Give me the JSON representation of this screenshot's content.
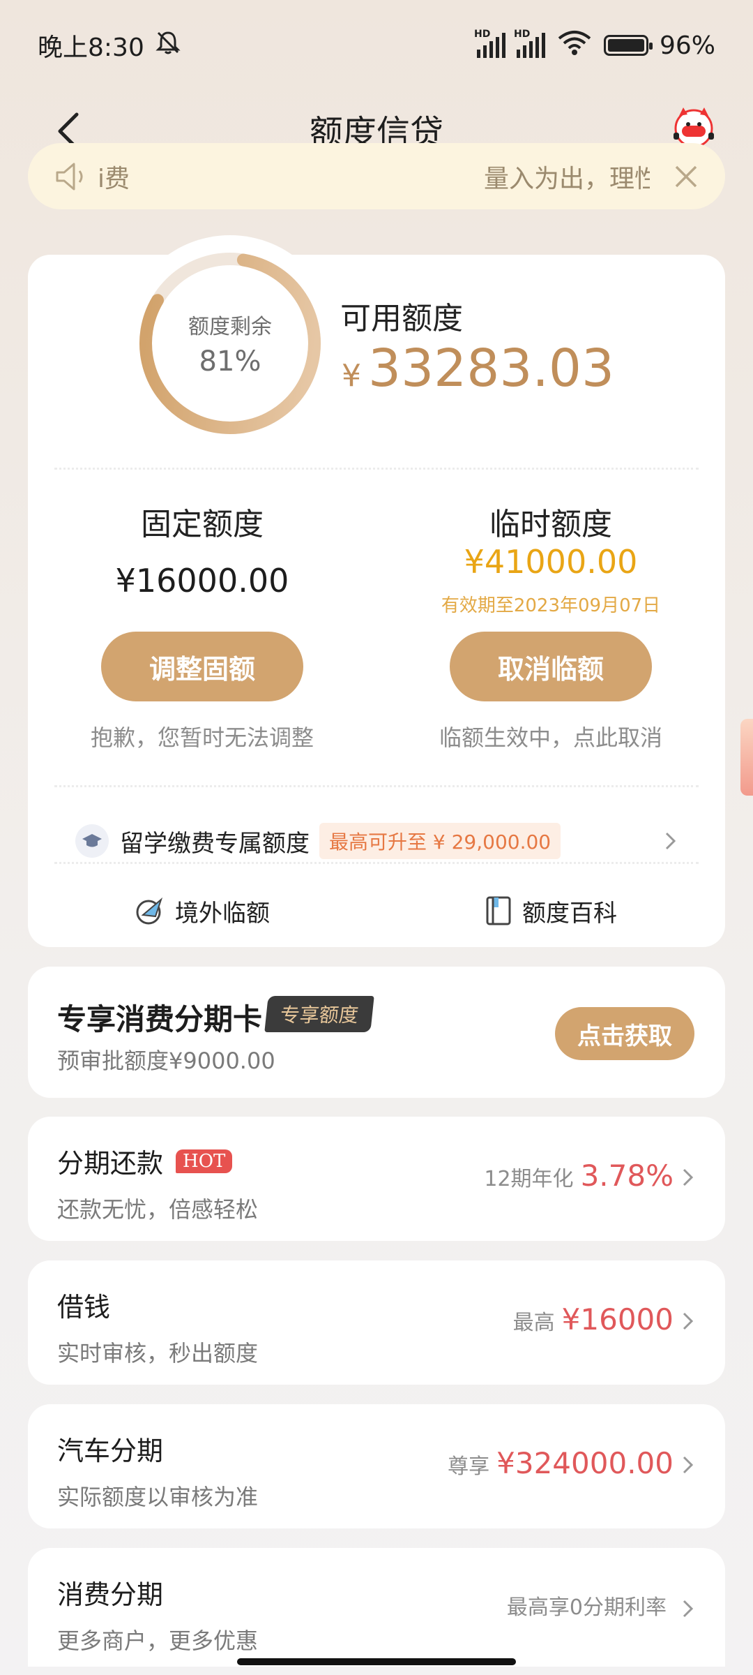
{
  "status_bar": {
    "time": "晚上8:30",
    "hd1": "HD",
    "hd2": "HD",
    "battery": "96%"
  },
  "nav": {
    "title": "额度信贷"
  },
  "notice": {
    "text_left": "i费",
    "text_right": "量入为出，理性"
  },
  "quota": {
    "ring_label": "额度剩余",
    "ring_percent": "81%",
    "ring_fraction": 0.81,
    "available_label": "可用额度",
    "currency_symbol": "¥",
    "available_amount": "33283.03",
    "fixed": {
      "title": "固定额度",
      "amount": "¥16000.00",
      "button": "调整固额",
      "note": "抱歉，您暂时无法调整"
    },
    "temporary": {
      "title": "临时额度",
      "amount": "¥41000.00",
      "valid_until": "有效期至2023年09月07日",
      "button": "取消临额",
      "note": "临额生效中，点此取消"
    },
    "study": {
      "label": "留学缴费专属额度",
      "tag": "最高可升至 ¥ 29,000.00"
    },
    "links": {
      "overseas": "境外临额",
      "encyclopedia": "额度百科"
    }
  },
  "special_card": {
    "title": "专享消费分期卡",
    "badge": "专享额度",
    "subtitle": "预审批额度¥9000.00",
    "button": "点击获取"
  },
  "products": [
    {
      "title": "分期还款",
      "badge": "HOT",
      "subtitle": "还款无忧，倍感轻松",
      "prefix": "12期年化",
      "value": "3.78%"
    },
    {
      "title": "借钱",
      "subtitle": "实时审核，秒出额度",
      "prefix": "最高",
      "value": "¥16000"
    },
    {
      "title": "汽车分期",
      "subtitle": "实际额度以审核为准",
      "prefix": "尊享",
      "value": "¥324000.00"
    },
    {
      "title": "消费分期",
      "subtitle": "更多商户，更多优惠",
      "prefix": "最高享0分期利率",
      "value": ""
    }
  ],
  "colors": {
    "gold": "#d2a46f",
    "amount_gold": "#c08e5a",
    "temp_gold": "#e9a515",
    "red": "#e0585a"
  }
}
